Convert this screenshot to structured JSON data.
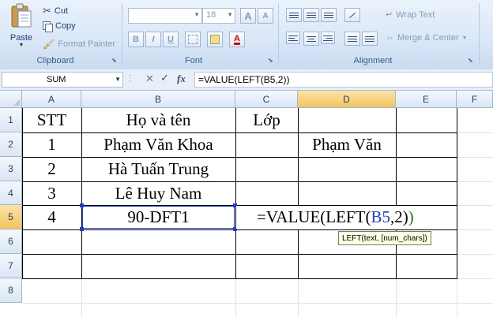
{
  "clipboard": {
    "paste_label": "Paste",
    "cut_label": "Cut",
    "copy_label": "Copy",
    "format_painter_label": "Format Painter",
    "group_label": "Clipboard"
  },
  "font": {
    "name_value": "",
    "size_value": "18",
    "grow_label": "A",
    "shrink_label": "A",
    "bold_label": "B",
    "italic_label": "I",
    "underline_label": "U",
    "group_label": "Font"
  },
  "alignment": {
    "wrap_text_label": "Wrap Text",
    "merge_center_label": "Merge & Center",
    "group_label": "Alignment"
  },
  "formula_bar": {
    "name_box_value": "SUM",
    "fx_label": "fx",
    "formula_value": "=VALUE(LEFT(B5,2))"
  },
  "grid": {
    "columns": [
      "A",
      "B",
      "C",
      "D",
      "E",
      "F"
    ],
    "rows": [
      "1",
      "2",
      "3",
      "4",
      "5",
      "6",
      "7",
      "8"
    ],
    "cells": {
      "A1": "STT",
      "B1": "Họ và tên",
      "C1": "Lớp",
      "A2": "1",
      "B2": "Phạm Văn Khoa",
      "D2": "Phạm Văn",
      "A3": "2",
      "B3": "Hà Tuấn Trung",
      "A4": "3",
      "B4": "Lê Huy Nam",
      "A5": "4",
      "B5": "90-DFT1"
    },
    "edit_formula": {
      "prefix": "=VALUE(LEFT(",
      "ref": "B5",
      "middle": ",2)",
      "suffix": ")"
    },
    "tooltip": "LEFT(text, [num_chars])"
  },
  "colors": {
    "ref_highlight": "#1f3fbf",
    "active_header": "#f6c35d",
    "paren_green": "#1b7a1b"
  }
}
